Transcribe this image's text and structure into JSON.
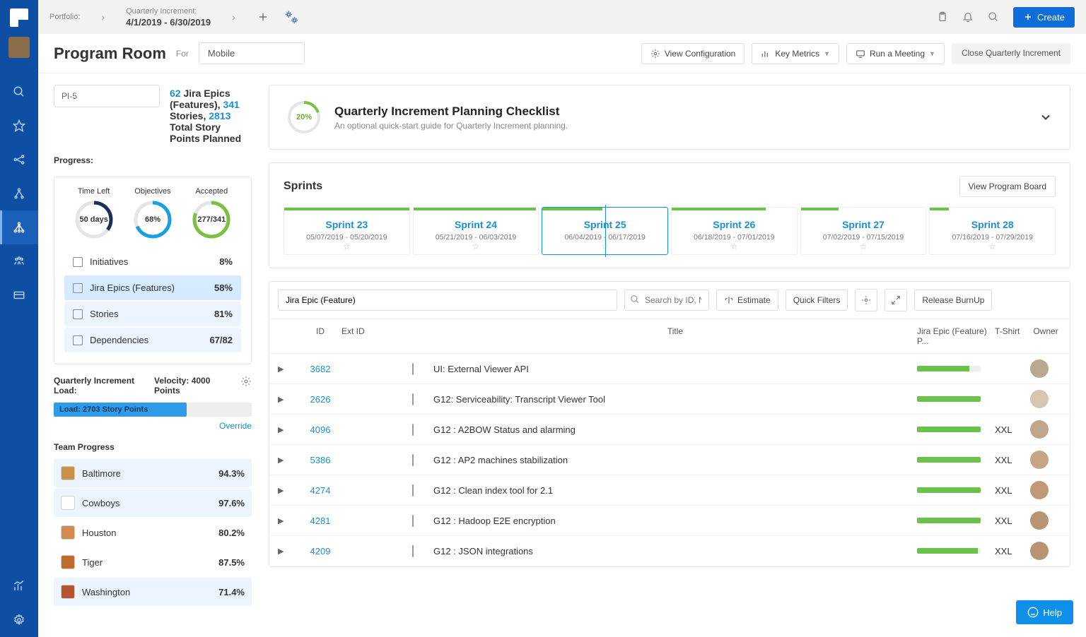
{
  "topbar": {
    "portfolio_label": "Portfolio:",
    "qi_label": "Quarterly Increment:",
    "qi_value": "4/1/2019 - 6/30/2019",
    "create": "Create"
  },
  "header": {
    "title": "Program Room",
    "for": "For",
    "dropdown": "Mobile",
    "view_config": "View Configuration",
    "key_metrics": "Key Metrics",
    "run_meeting": "Run a Meeting",
    "close_qi": "Close Quarterly Increment"
  },
  "pi_input": "PI-5",
  "summary": {
    "epics_n": "62",
    "epics_t": "Jira Epics (Features),",
    "stories_n": "341",
    "stories_t": "Stories,",
    "points_n": "2813",
    "points_t": "Total Story Points Planned"
  },
  "progress_label": "Progress:",
  "rings": {
    "time_left": {
      "title": "Time Left",
      "value": "50 days",
      "pct": 35
    },
    "objectives": {
      "title": "Objectives",
      "value": "68%",
      "pct": 68
    },
    "accepted": {
      "title": "Accepted",
      "value": "277/341",
      "pct": 81
    }
  },
  "types": [
    {
      "label": "Initiatives",
      "pct": "8%"
    },
    {
      "label": "Jira Epics (Features)",
      "pct": "58%"
    },
    {
      "label": "Stories",
      "pct": "81%"
    },
    {
      "label": "Dependencies",
      "pct": "67/82"
    }
  ],
  "load": {
    "left_title": "Quarterly Increment Load:",
    "right_title": "Velocity: 4000 Points",
    "bar_text": "Load: 2703 Story Points",
    "bar_pct": 67,
    "override": "Override"
  },
  "team_progress_title": "Team Progress",
  "teams": [
    {
      "name": "Baltimore",
      "pct": "94.3%",
      "color": "#c9914a"
    },
    {
      "name": "Cowboys",
      "pct": "97.6%",
      "color": "#ffffff"
    },
    {
      "name": "Houston",
      "pct": "80.2%",
      "color": "#d38a4f"
    },
    {
      "name": "Tiger",
      "pct": "87.5%",
      "color": "#c06b2e"
    },
    {
      "name": "Washington",
      "pct": "71.4%",
      "color": "#b5542e"
    }
  ],
  "checklist": {
    "pct": "20%",
    "title": "Quarterly Increment Planning Checklist",
    "subtitle": "An optional quick-start guide for Quarterly Increment planning."
  },
  "sprints_title": "Sprints",
  "view_board": "View Program Board",
  "sprints": [
    {
      "name": "Sprint 23",
      "dates": "05/07/2019 - 05/20/2019",
      "prog": 100
    },
    {
      "name": "Sprint 24",
      "dates": "05/21/2019 - 06/03/2019",
      "prog": 98
    },
    {
      "name": "Sprint 25",
      "dates": "06/04/2019 - 06/17/2019",
      "prog": 48,
      "active": true
    },
    {
      "name": "Sprint 26",
      "dates": "06/18/2019 - 07/01/2019",
      "prog": 75
    },
    {
      "name": "Sprint 27",
      "dates": "07/02/2019 - 07/15/2019",
      "prog": 30
    },
    {
      "name": "Sprint 28",
      "dates": "07/16/2019 - 07/29/2019",
      "prog": 15
    }
  ],
  "table": {
    "filter_value": "Jira Epic (Feature)",
    "search_placeholder": "Search by ID, Name",
    "estimate": "Estimate",
    "quick_filters": "Quick Filters",
    "release": "Release BurnUp",
    "cols": {
      "id": "ID",
      "ext": "Ext ID",
      "title": "Title",
      "prog": "Jira Epic (Feature) P...",
      "tshirt": "T-Shirt",
      "owner": "Owner"
    },
    "rows": [
      {
        "id": "3682",
        "title": "UI: External Viewer API",
        "prog": 82,
        "tshirt": "",
        "avatar": "#b8a890"
      },
      {
        "id": "2626",
        "title": "G12: Serviceability: Transcript Viewer Tool",
        "prog": 100,
        "tshirt": "",
        "avatar": "#d8c5b0"
      },
      {
        "id": "4096",
        "title": "G12 : A2BOW Status and alarming",
        "prog": 100,
        "tshirt": "XXL",
        "avatar": "#bfa58a"
      },
      {
        "id": "5386",
        "title": "G12 : AP2 machines stabilization",
        "prog": 100,
        "tshirt": "XXL",
        "avatar": "#c5a585"
      },
      {
        "id": "4274",
        "title": "G12 : Clean index tool for 2.1",
        "prog": 100,
        "tshirt": "XXL",
        "avatar": "#c09878"
      },
      {
        "id": "4281",
        "title": "G12 : Hadoop E2E encryption",
        "prog": 100,
        "tshirt": "XXL",
        "avatar": "#b89570"
      },
      {
        "id": "4209",
        "title": "G12 : JSON integrations",
        "prog": 95,
        "tshirt": "XXL",
        "avatar": "#b89570"
      }
    ]
  },
  "help": "Help"
}
